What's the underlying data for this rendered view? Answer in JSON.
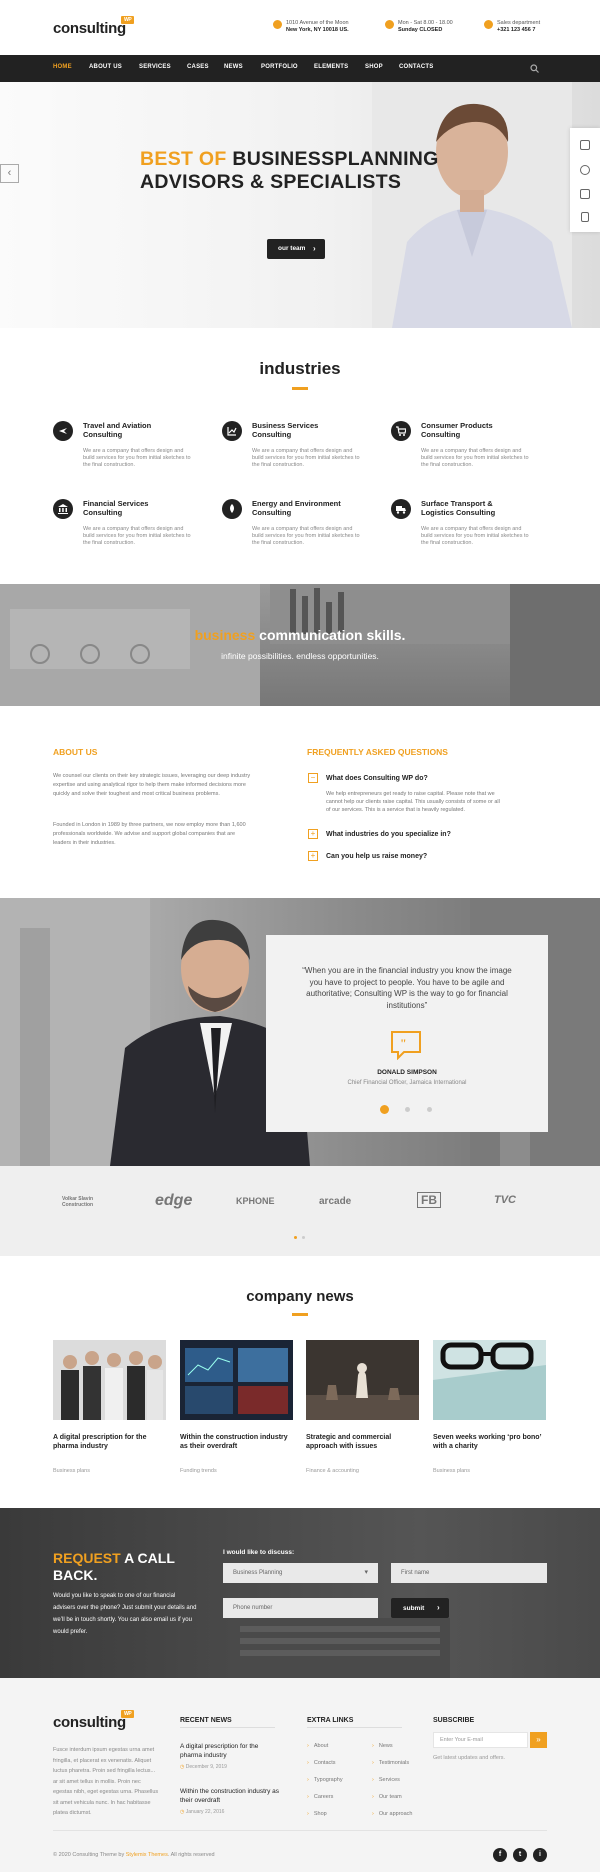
{
  "brand": {
    "name": "consulting",
    "badge": "WP",
    "accent": "#f0a020",
    "dark": "#222222"
  },
  "header": {
    "address_line1": "1010 Avenue of the Moon",
    "address_line2": "New York, NY 10018 US.",
    "hours_line1": "Mon - Sat 8.00 - 18.00",
    "hours_line2": "Sunday CLOSED",
    "phone_line1": "Sales department",
    "phone_line2": "+321 123 456 7"
  },
  "nav": [
    "HOME",
    "ABOUT US",
    "SERVICES",
    "CASES",
    "NEWS",
    "PORTFOLIO",
    "ELEMENTS",
    "SHOP",
    "CONTACTS"
  ],
  "hero": {
    "accent": "BEST OF",
    "line1": "BUSINESSPLANNING",
    "line2": "ADVISORS & SPECIALISTS",
    "button": "our team"
  },
  "industries": {
    "title": "industries",
    "items": [
      {
        "icon": "plane-icon",
        "title1": "Travel and Aviation",
        "title2": "Consulting",
        "desc1": "We are a company that offers design and",
        "desc2": "build services for you from initial sketches to",
        "desc3": "the final construction."
      },
      {
        "icon": "chart-icon",
        "title1": "Business Services",
        "title2": "Consulting",
        "desc1": "We are a company that offers design and",
        "desc2": "build services for you from initial sketches to",
        "desc3": "the final construction."
      },
      {
        "icon": "cart-icon",
        "title1": "Consumer Products",
        "title2": "Consulting",
        "desc1": "We are a company that offers design and",
        "desc2": "build services for you from initial sketches to",
        "desc3": "the final construction."
      },
      {
        "icon": "bank-icon",
        "title1": "Financial Services",
        "title2": "Consulting",
        "desc1": "We are a company that offers design and",
        "desc2": "build services for you from initial sketches to",
        "desc3": "the final construction."
      },
      {
        "icon": "energy-icon",
        "title1": "Energy and Environment",
        "title2": "Consulting",
        "desc1": "We are a company that offers design and",
        "desc2": "build services for you from initial sketches to",
        "desc3": "the final construction."
      },
      {
        "icon": "truck-icon",
        "title1": "Surface Transport &",
        "title2": "Logistics Consulting",
        "desc1": "We are a company that offers design and",
        "desc2": "build services for you from initial sketches to",
        "desc3": "the final construction."
      }
    ]
  },
  "band": {
    "accent": "business",
    "rest": "communication skills.",
    "sub": "infinite possibilities. endless opportunities."
  },
  "about": {
    "label": "ABOUT US",
    "p1": [
      "We counsel our clients on their key strategic issues, leveraging our deep industry",
      "expertise and using analytical rigor to help them make informed decisions more",
      "quickly and solve their toughest and most critical business problems."
    ],
    "p2": [
      "Founded in London in 1989 by three partners, we now employ more than 1,600",
      "professionals worldwide. We advise and support global companies that are",
      "leaders in their industries."
    ]
  },
  "faq": {
    "label": "FREQUENTLY ASKED QUESTIONS",
    "q1": "What does Consulting WP do?",
    "a1": [
      "We help entrepreneurs get ready to raise capital. Please note that we",
      "cannot help our clients raise capital. This usually consists of some or all",
      "of our services. This is a service that is heavily regulated."
    ],
    "q2": "What industries do you specialize in?",
    "q3": "Can you help us raise money?"
  },
  "testimonial": {
    "quote": [
      "“When you are in the financial industry you know the image",
      "you have to project to people. You have to be agile and",
      "authoritative; Consulting WP is the way to go for financial",
      "institutions”"
    ],
    "name": "DONALD SIMPSON",
    "role": "Chief Financial Officer, Jamaica International"
  },
  "partners": [
    "Volkar Slavin Construction",
    "edge",
    "KPHONE",
    "arcade",
    "FB",
    "TVC"
  ],
  "news": {
    "title": "company news",
    "items": [
      {
        "t1": "A digital prescription for the",
        "t2": "pharma industry",
        "cat": "Business plans"
      },
      {
        "t1": "Within the construction industry",
        "t2": "as their overdraft",
        "cat": "Funding trends"
      },
      {
        "t1": "Strategic and commercial",
        "t2": "approach with issues",
        "cat": "Finance & accounting"
      },
      {
        "t1": "Seven weeks working ‘pro bono’",
        "t2": "with a charity",
        "cat": "Business plans"
      }
    ]
  },
  "callback": {
    "accent": "REQUEST",
    "rest1": "A CALL",
    "rest2": "BACK.",
    "text": [
      "Would you like to speak to one of our financial",
      "advisers over the phone? Just submit your details and",
      "we’ll be in touch shortly. You can also email us if you",
      "would prefer."
    ],
    "discuss_label": "I would like to discuss:",
    "select_value": "Business Planning",
    "first_name": "First name",
    "phone": "Phone number",
    "submit": "submit"
  },
  "footer": {
    "about": [
      "Fusce interdum ipsum egestas urna amet",
      "fringilla, et placerat ex venenatis. Aliquet",
      "luctus pharetra. Proin sed fringilla lectus...",
      "ar sit amet tellus in mollis. Proin nec",
      "egestas nibh, eget egestas urna. Phasellus",
      "sit amet vehicula nunc. In hac habitasse",
      "platea dictumst."
    ],
    "recent_h": "RECENT NEWS",
    "recent": [
      {
        "t1": "A digital prescription for the",
        "t2": "pharma industry",
        "date": "December 9, 2019"
      },
      {
        "t1": "Within the construction industry as",
        "t2": "their overdraft",
        "date": "January 22, 2016"
      }
    ],
    "links_h": "EXTRA LINKS",
    "links_a": [
      "About",
      "Contacts",
      "Typography",
      "Careers",
      "Shop"
    ],
    "links_b": [
      "News",
      "Testimonials",
      "Services",
      "Our team",
      "Our approach"
    ],
    "subscribe_h": "SUBSCRIBE",
    "email_placeholder": "Enter Your E-mail",
    "subscribe_note": "Get latest updates and offers.",
    "copyright": "© 2020 Consulting Theme by",
    "copyright_link": "Stylemix Themes",
    "copyright_end": ". All rights reserved",
    "social": [
      "f",
      "t",
      "i"
    ]
  }
}
